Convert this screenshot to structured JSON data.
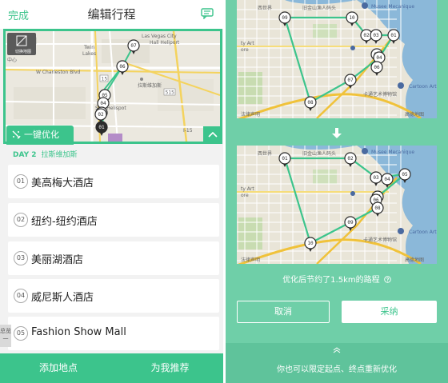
{
  "header": {
    "done_label": "完成",
    "title": "编辑行程"
  },
  "map_left": {
    "layer_label": "切换地图",
    "labels": {
      "vegas_city": "Las Vegas City",
      "heliport": "Hall Heliport",
      "twin_lakes": "Twin",
      "lakes": "Lakes",
      "charleston": "W Charleston Blvd",
      "hwy_95": "95",
      "hwy_15": "15",
      "hwy_515": "515",
      "las_vegas_cn": "拉斯维加斯",
      "stardust_heliport": "Star     Helispot",
      "i15": "I-15",
      "left_cut": "中心"
    },
    "pins": [
      "07",
      "06",
      "05",
      "04",
      "03",
      "02",
      "01"
    ]
  },
  "optimize_label": "一键优化",
  "day": {
    "label": "DAY 2",
    "city": "拉斯维加斯"
  },
  "stops": [
    {
      "num": "01",
      "name": "美高梅大酒店"
    },
    {
      "num": "02",
      "name": "纽约-纽约酒店"
    },
    {
      "num": "03",
      "name": "美丽湖酒店"
    },
    {
      "num": "04",
      "name": "威尼斯人酒店"
    },
    {
      "num": "05",
      "name": "Fashion Show Mall"
    }
  ],
  "side_tab": "总览\n一",
  "bottom": {
    "add_label": "添加地点",
    "recommend_label": "为我推荐"
  },
  "map_right": {
    "labels": {
      "mechanique": "Musee Mecanique",
      "ghirardelli": "旧金山渔人码头",
      "cartoon": "Cartoon Art Museum",
      "cartoon_cn": "卡通艺术博物馆",
      "gallery": "ty Art",
      "gallery2": "ore",
      "maps_mark": "高德地图",
      "legal": "法律声明",
      "west": "西世界"
    },
    "before_pins": [
      "09",
      "10",
      "02",
      "03",
      "01",
      "05",
      "04",
      "06",
      "07",
      "08"
    ],
    "after_pins": [
      "01",
      "02",
      "03",
      "04",
      "05",
      "07",
      "06",
      "08",
      "09",
      "10"
    ]
  },
  "result": {
    "saving_text": "优化后节约了1.5km的路程",
    "cancel_label": "取消",
    "accept_label": "采纳",
    "reoptimize_text": "你也可以限定起点、终点重新优化"
  },
  "colors": {
    "accent": "#3cc48c",
    "route": "#3cc48c",
    "panel_bg": "#6fcfa8"
  }
}
